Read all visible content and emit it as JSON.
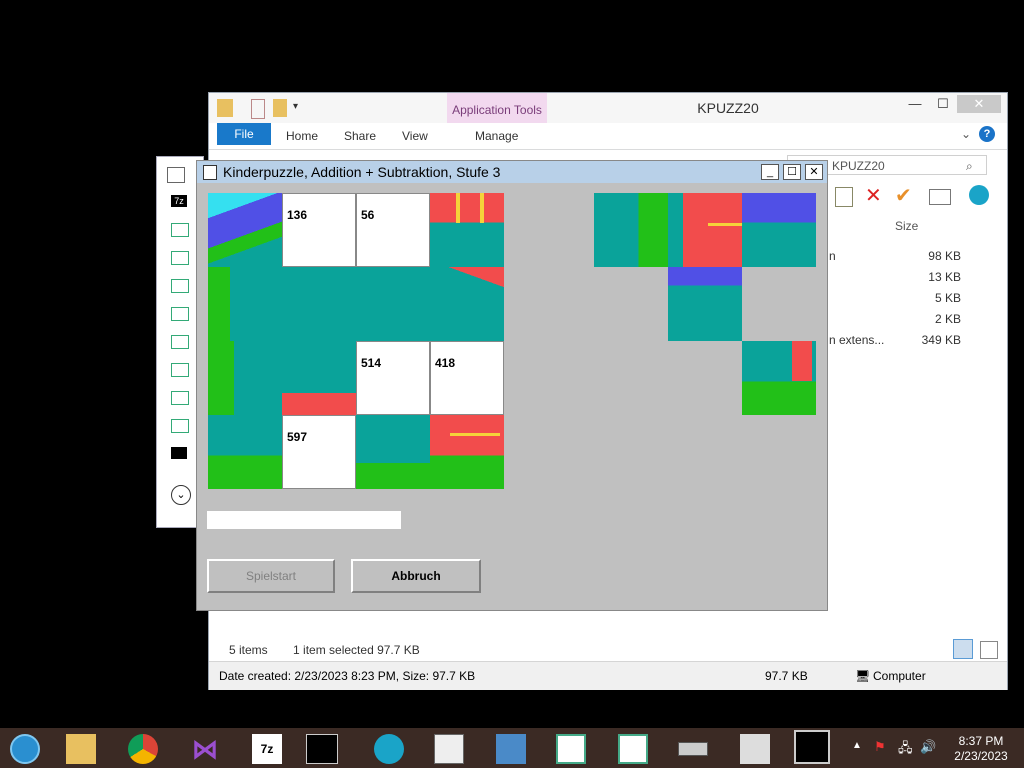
{
  "explorer": {
    "title": "KPUZZ20",
    "app_tools": "Application Tools",
    "tabs": [
      "File",
      "Home",
      "Share",
      "View"
    ],
    "manage": "Manage",
    "address_fragment": "KPUZZ20",
    "size_header": "Size",
    "sizes": [
      "98 KB",
      "13 KB",
      "5 KB",
      "2 KB",
      "349 KB"
    ],
    "name_fragments": [
      "n",
      "n extens..."
    ],
    "items_count": "5 items",
    "selected_info": "1 item selected  97.7 KB",
    "date_info": "Date created: 2/23/2023 8:23 PM, Size: 97.7 KB",
    "status_size": "97.7 KB",
    "computer": "Computer"
  },
  "puzzle": {
    "title": "Kinderpuzzle, Addition + Subtraktion, Stufe  3",
    "numbers": {
      "a": "136",
      "b": "56",
      "c": "514",
      "d": "418",
      "e": "597"
    },
    "start_button": "Spielstart",
    "cancel_button": "Abbruch",
    "colors": {
      "teal": "#0aa39a",
      "red": "#f24c4c",
      "yellow": "#f5d23a",
      "sky": "#5050e6",
      "grass": "#22c018",
      "bg": "#c0c0c0"
    }
  },
  "taskbar": {
    "time": "8:37 PM",
    "date": "2/23/2023",
    "icons": [
      "start-orb-icon",
      "file-explorer-icon",
      "chrome-icon",
      "visual-studio-icon",
      "7zip-icon",
      "cmd-icon",
      "shell-icon",
      "vcdic-icon",
      "photo-icon",
      "app-window-icon",
      "app-window-icon-2",
      "drive-icon",
      "monitor-icon",
      "kpuzz-icon"
    ]
  }
}
